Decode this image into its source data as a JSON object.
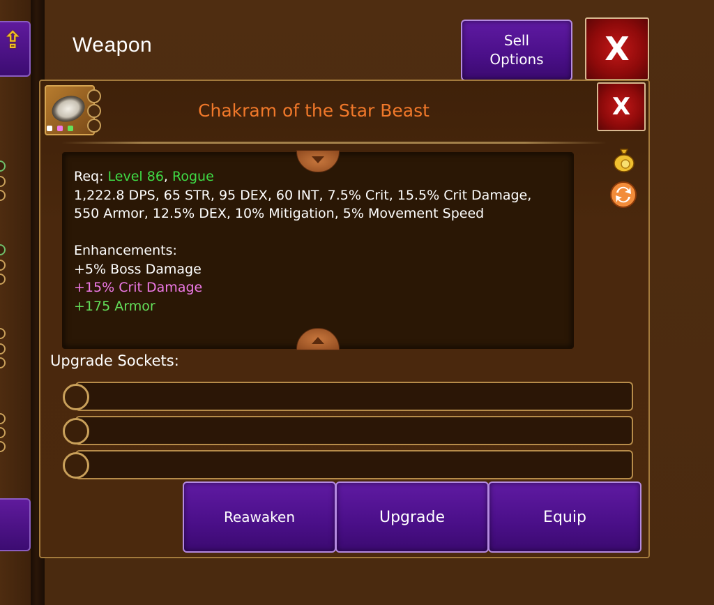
{
  "header": {
    "title": "Weapon",
    "sell_options_line1": "Sell",
    "sell_options_line2": "Options",
    "close_label": "X"
  },
  "item": {
    "name": "Chakram of the Star Beast",
    "close_label": "X",
    "name_color": "#f0782a",
    "gem_colors": [
      "#ffffff",
      "#f07ae8",
      "#64e05a"
    ],
    "requirements": {
      "prefix": "Req: ",
      "level": "Level 86",
      "separator": ", ",
      "class": "Rogue"
    },
    "stats_line1": "1,222.8 DPS, 65 STR, 95 DEX, 60 INT, 7.5% Crit, 15.5% Crit Damage,",
    "stats_line2": "550 Armor, 12.5% DEX, 10% Mitigation, 5% Movement Speed",
    "enhancements_heading": "Enhancements:",
    "enhancements": [
      {
        "text": "+5% Boss Damage",
        "color": "#ffffff"
      },
      {
        "text": "+15% Crit Damage",
        "color": "#f07ae8"
      },
      {
        "text": "+175 Armor",
        "color": "#64e05a"
      }
    ]
  },
  "sockets": {
    "label": "Upgrade Sockets:",
    "count": 3
  },
  "actions": {
    "reawaken": "Reawaken",
    "upgrade": "Upgrade",
    "equip": "Equip"
  },
  "icons": {
    "side_arrow": "up-arrow-icon",
    "bag": "gold-bag-icon",
    "swap": "swap-icon",
    "item": "chakram-icon"
  }
}
